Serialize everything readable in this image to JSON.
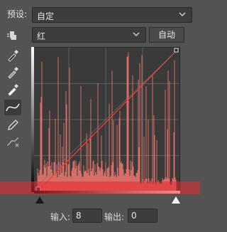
{
  "preset": {
    "label": "预设:",
    "value": "自定"
  },
  "channel": {
    "value": "红"
  },
  "auto_button": {
    "label": "自动"
  },
  "input": {
    "label": "输入:",
    "value": "8"
  },
  "output": {
    "label": "输出:",
    "value": "0"
  },
  "tools": [
    {
      "name": "on-image-adjust-icon"
    },
    {
      "name": "black-point-eyedropper-icon"
    },
    {
      "name": "gray-point-eyedropper-icon"
    },
    {
      "name": "white-point-eyedropper-icon"
    },
    {
      "name": "curve-point-tool-icon"
    },
    {
      "name": "pencil-draw-icon"
    },
    {
      "name": "smooth-curve-icon"
    }
  ],
  "colors": {
    "histogram": "#f0786e",
    "curve": "#ff3b30",
    "panel": "#535353"
  }
}
